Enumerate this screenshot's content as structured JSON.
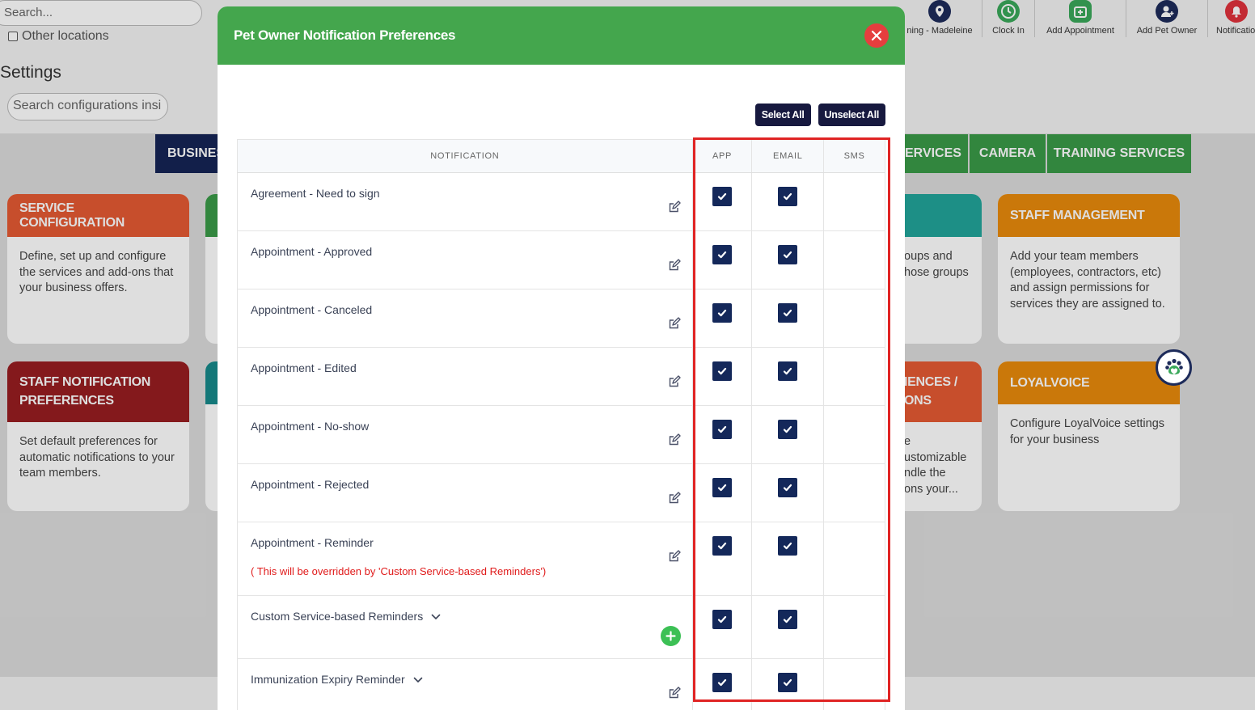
{
  "top": {
    "search_placeholder": "Search...",
    "other_locations": "Other locations",
    "nav": [
      {
        "label": "ning - Madeleine",
        "icon": "location-pin-icon",
        "color": "#1d2b5a"
      },
      {
        "label": "Clock In",
        "icon": "clock-icon",
        "color": "#3aa85a"
      },
      {
        "label": "Add Appointment",
        "icon": "calendar-add-icon",
        "color": "#3aa85a"
      },
      {
        "label": "Add Pet Owner",
        "icon": "add-user-icon",
        "color": "#1d2b5a"
      },
      {
        "label": "Notificatio",
        "icon": "bell-icon",
        "color": "#e0323c"
      }
    ]
  },
  "settings": {
    "title": "Settings",
    "search_placeholder": "Search configurations insi"
  },
  "category_tabs": [
    {
      "label": "BUSINES",
      "color": "#152456"
    },
    {
      "label": "ERVICES",
      "color": "#3a9a48"
    },
    {
      "label": "CAMERA",
      "color": "#3a9a48"
    },
    {
      "label": "TRAINING SERVICES",
      "color": "#3a9a48"
    }
  ],
  "cards": {
    "service_config": {
      "title": "SERVICE CONFIGURATION",
      "body": "Define, set up and configure the services and add-ons that your business offers.",
      "color": "#e55a33"
    },
    "groups_partial": {
      "body": "oups and\nhose groups",
      "color": "#22a59a"
    },
    "staff_management": {
      "title": "STAFF MANAGEMENT",
      "body": "Add your team members (employees, contractors, etc) and assign permissions for services they are assigned to.",
      "color": "#e98a0c"
    },
    "staff_notif": {
      "title": "STAFF NOTIFICATION PREFERENCES",
      "body": "Set default preferences for automatic notifications to your team members.",
      "color": "#981d21"
    },
    "experiences_partial": {
      "title": "IENCES /\nONS",
      "body": "e\nustomizable\nndle the\nons your...",
      "color": "#e55a33"
    },
    "loyalvoice": {
      "title": "LOYALVOICE",
      "body": "Configure LoyalVoice settings for your business",
      "color": "#e98a0c"
    }
  },
  "modal": {
    "title": "Pet Owner Notification Preferences",
    "select_all": "Select All",
    "unselect_all": "Unselect All",
    "columns": {
      "notification": "NOTIFICATION",
      "app": "APP",
      "email": "EMAIL",
      "sms": "SMS"
    },
    "rows": [
      {
        "label": "Agreement - Need to sign",
        "app": true,
        "email": true,
        "sms": false
      },
      {
        "label": "Appointment - Approved",
        "app": true,
        "email": true,
        "sms": false
      },
      {
        "label": "Appointment - Canceled",
        "app": true,
        "email": true,
        "sms": false
      },
      {
        "label": "Appointment - Edited",
        "app": true,
        "email": true,
        "sms": false
      },
      {
        "label": "Appointment - No-show",
        "app": true,
        "email": true,
        "sms": false
      },
      {
        "label": "Appointment - Rejected",
        "app": true,
        "email": true,
        "sms": false
      },
      {
        "label": "Appointment - Reminder",
        "note": "( This will be overridden by 'Custom Service-based Reminders')",
        "app": true,
        "email": true,
        "sms": false
      },
      {
        "label": "Custom Service-based Reminders",
        "expandable": true,
        "app": true,
        "email": true,
        "sms": false
      },
      {
        "label": "Immunization Expiry Reminder",
        "expandable": true,
        "app": true,
        "email": true,
        "sms": false
      }
    ]
  }
}
